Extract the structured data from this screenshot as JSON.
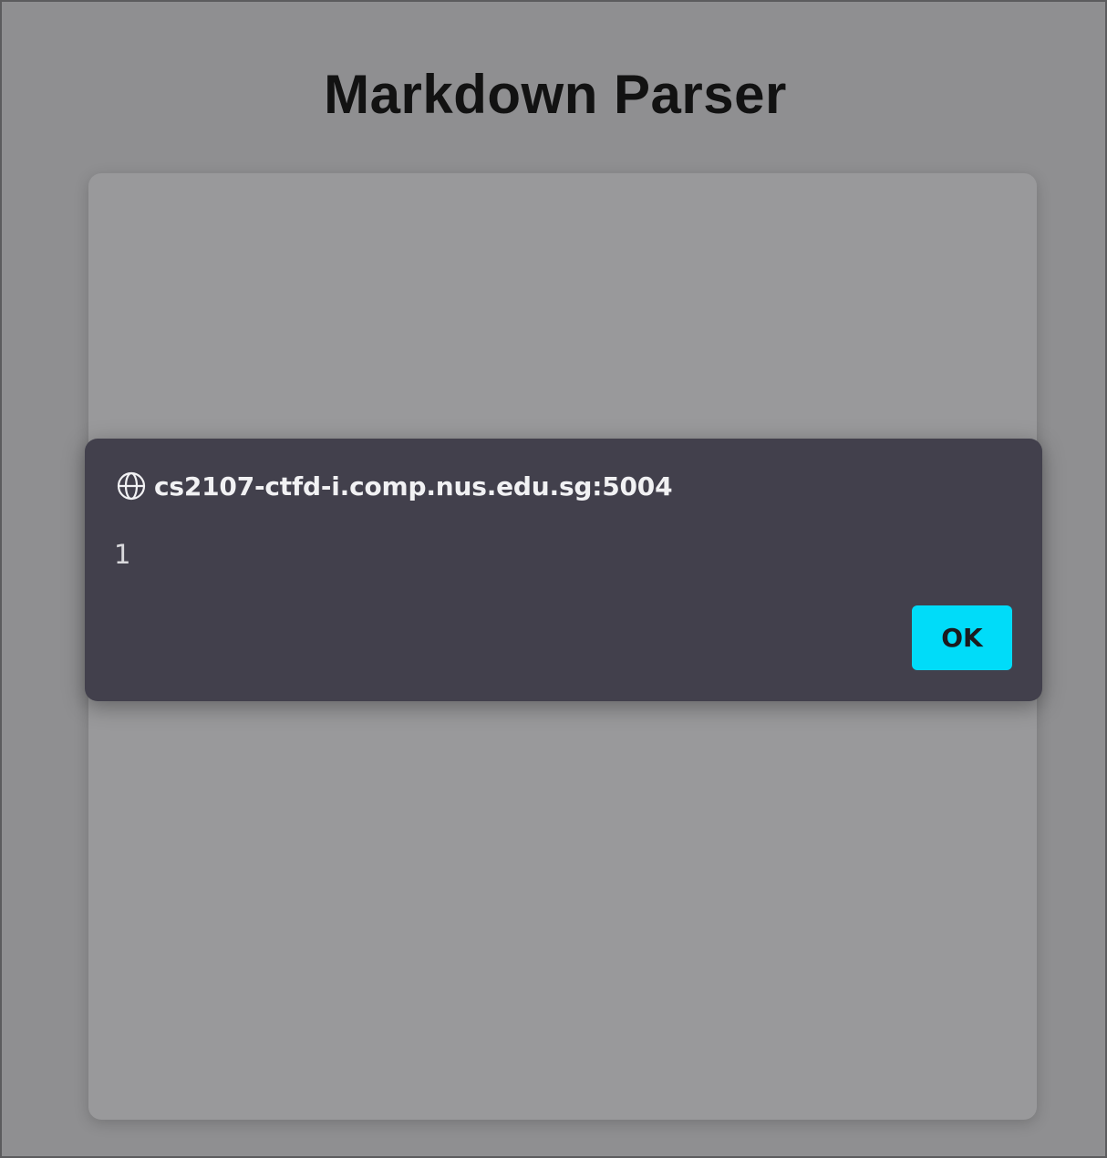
{
  "page": {
    "title": "Markdown Parser"
  },
  "dialog": {
    "origin": "cs2107-ctfd-i.comp.nus.edu.sg:5004",
    "message": "1",
    "ok_label": "OK",
    "icon": "globe-icon"
  },
  "colors": {
    "overlay_background": "#8f8f91",
    "card_background": "#99999b",
    "dialog_background": "#42404c",
    "ok_button": "#00dcf9",
    "title_text": "#121212"
  }
}
